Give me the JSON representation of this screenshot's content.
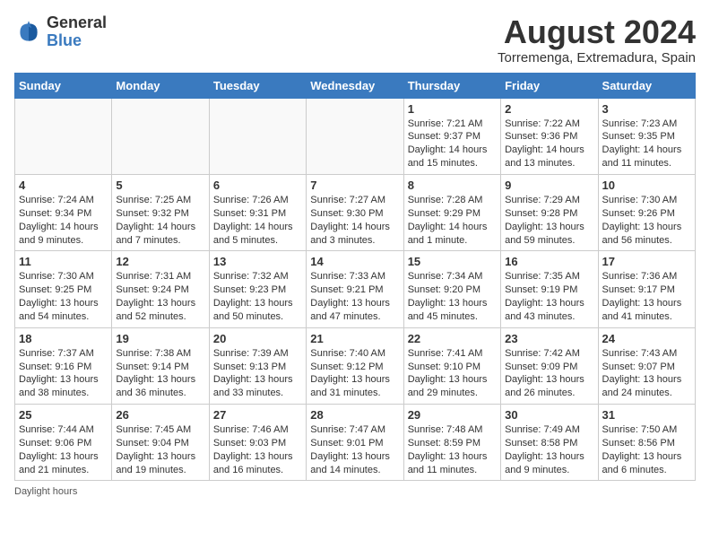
{
  "header": {
    "logo_line1": "General",
    "logo_line2": "Blue",
    "title": "August 2024",
    "subtitle": "Torremenga, Extremadura, Spain"
  },
  "calendar": {
    "days_of_week": [
      "Sunday",
      "Monday",
      "Tuesday",
      "Wednesday",
      "Thursday",
      "Friday",
      "Saturday"
    ],
    "weeks": [
      [
        {
          "day": "",
          "info": ""
        },
        {
          "day": "",
          "info": ""
        },
        {
          "day": "",
          "info": ""
        },
        {
          "day": "",
          "info": ""
        },
        {
          "day": "1",
          "info": "Sunrise: 7:21 AM\nSunset: 9:37 PM\nDaylight: 14 hours and 15 minutes."
        },
        {
          "day": "2",
          "info": "Sunrise: 7:22 AM\nSunset: 9:36 PM\nDaylight: 14 hours and 13 minutes."
        },
        {
          "day": "3",
          "info": "Sunrise: 7:23 AM\nSunset: 9:35 PM\nDaylight: 14 hours and 11 minutes."
        }
      ],
      [
        {
          "day": "4",
          "info": "Sunrise: 7:24 AM\nSunset: 9:34 PM\nDaylight: 14 hours and 9 minutes."
        },
        {
          "day": "5",
          "info": "Sunrise: 7:25 AM\nSunset: 9:32 PM\nDaylight: 14 hours and 7 minutes."
        },
        {
          "day": "6",
          "info": "Sunrise: 7:26 AM\nSunset: 9:31 PM\nDaylight: 14 hours and 5 minutes."
        },
        {
          "day": "7",
          "info": "Sunrise: 7:27 AM\nSunset: 9:30 PM\nDaylight: 14 hours and 3 minutes."
        },
        {
          "day": "8",
          "info": "Sunrise: 7:28 AM\nSunset: 9:29 PM\nDaylight: 14 hours and 1 minute."
        },
        {
          "day": "9",
          "info": "Sunrise: 7:29 AM\nSunset: 9:28 PM\nDaylight: 13 hours and 59 minutes."
        },
        {
          "day": "10",
          "info": "Sunrise: 7:30 AM\nSunset: 9:26 PM\nDaylight: 13 hours and 56 minutes."
        }
      ],
      [
        {
          "day": "11",
          "info": "Sunrise: 7:30 AM\nSunset: 9:25 PM\nDaylight: 13 hours and 54 minutes."
        },
        {
          "day": "12",
          "info": "Sunrise: 7:31 AM\nSunset: 9:24 PM\nDaylight: 13 hours and 52 minutes."
        },
        {
          "day": "13",
          "info": "Sunrise: 7:32 AM\nSunset: 9:23 PM\nDaylight: 13 hours and 50 minutes."
        },
        {
          "day": "14",
          "info": "Sunrise: 7:33 AM\nSunset: 9:21 PM\nDaylight: 13 hours and 47 minutes."
        },
        {
          "day": "15",
          "info": "Sunrise: 7:34 AM\nSunset: 9:20 PM\nDaylight: 13 hours and 45 minutes."
        },
        {
          "day": "16",
          "info": "Sunrise: 7:35 AM\nSunset: 9:19 PM\nDaylight: 13 hours and 43 minutes."
        },
        {
          "day": "17",
          "info": "Sunrise: 7:36 AM\nSunset: 9:17 PM\nDaylight: 13 hours and 41 minutes."
        }
      ],
      [
        {
          "day": "18",
          "info": "Sunrise: 7:37 AM\nSunset: 9:16 PM\nDaylight: 13 hours and 38 minutes."
        },
        {
          "day": "19",
          "info": "Sunrise: 7:38 AM\nSunset: 9:14 PM\nDaylight: 13 hours and 36 minutes."
        },
        {
          "day": "20",
          "info": "Sunrise: 7:39 AM\nSunset: 9:13 PM\nDaylight: 13 hours and 33 minutes."
        },
        {
          "day": "21",
          "info": "Sunrise: 7:40 AM\nSunset: 9:12 PM\nDaylight: 13 hours and 31 minutes."
        },
        {
          "day": "22",
          "info": "Sunrise: 7:41 AM\nSunset: 9:10 PM\nDaylight: 13 hours and 29 minutes."
        },
        {
          "day": "23",
          "info": "Sunrise: 7:42 AM\nSunset: 9:09 PM\nDaylight: 13 hours and 26 minutes."
        },
        {
          "day": "24",
          "info": "Sunrise: 7:43 AM\nSunset: 9:07 PM\nDaylight: 13 hours and 24 minutes."
        }
      ],
      [
        {
          "day": "25",
          "info": "Sunrise: 7:44 AM\nSunset: 9:06 PM\nDaylight: 13 hours and 21 minutes."
        },
        {
          "day": "26",
          "info": "Sunrise: 7:45 AM\nSunset: 9:04 PM\nDaylight: 13 hours and 19 minutes."
        },
        {
          "day": "27",
          "info": "Sunrise: 7:46 AM\nSunset: 9:03 PM\nDaylight: 13 hours and 16 minutes."
        },
        {
          "day": "28",
          "info": "Sunrise: 7:47 AM\nSunset: 9:01 PM\nDaylight: 13 hours and 14 minutes."
        },
        {
          "day": "29",
          "info": "Sunrise: 7:48 AM\nSunset: 8:59 PM\nDaylight: 13 hours and 11 minutes."
        },
        {
          "day": "30",
          "info": "Sunrise: 7:49 AM\nSunset: 8:58 PM\nDaylight: 13 hours and 9 minutes."
        },
        {
          "day": "31",
          "info": "Sunrise: 7:50 AM\nSunset: 8:56 PM\nDaylight: 13 hours and 6 minutes."
        }
      ]
    ]
  },
  "footer": {
    "note": "Daylight hours"
  }
}
